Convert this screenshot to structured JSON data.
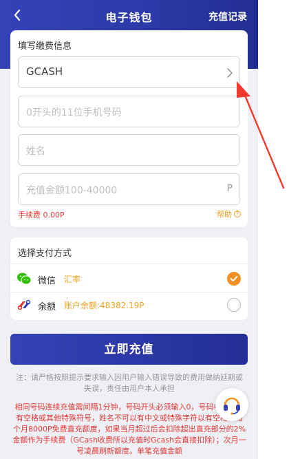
{
  "header": {
    "title": "电子钱包",
    "records_label": "充值记录"
  },
  "form": {
    "title": "填写缴费信息",
    "channel_value": "GCASH",
    "phone_placeholder": "0开头的11位手机号码",
    "name_placeholder": "姓名",
    "amount_placeholder": "充值金额100-40000",
    "amount_suffix": "P",
    "fee_text": "手续费 0.00P",
    "help_label": "帮助"
  },
  "payment": {
    "title": "选择支付方式",
    "methods": [
      {
        "name": "微信",
        "note": "汇率",
        "selected": true,
        "icon": "wechat-icon"
      },
      {
        "name": "余额",
        "note": "账户余额:48382.19P",
        "selected": false,
        "icon": "balance-icon"
      }
    ]
  },
  "submit_label": "立即充值",
  "note_text": "注：请严格按照提示要求输入因用户输入错误导致的费用做纳延期或失误，责任由用户本人承担",
  "warning_text": "相同号码连续充值需间隔1分钟，号码开头必须输入0，号码中不可以有空格或其他特殊符号，姓名不可以有中文或特殊字符以有空格。每个月8000P免费直充额度，如果当月超过后会扣除超出直充部分的2%金额作为手续费（GCash收费所以充值时Gcash会直接扣除）；次月一号凌晨刷新额度。单笔充值金额",
  "colors": {
    "primary": "#2d3aa8",
    "accent": "#f09020",
    "danger": "#e53935",
    "annotation": "#f03a2e"
  }
}
